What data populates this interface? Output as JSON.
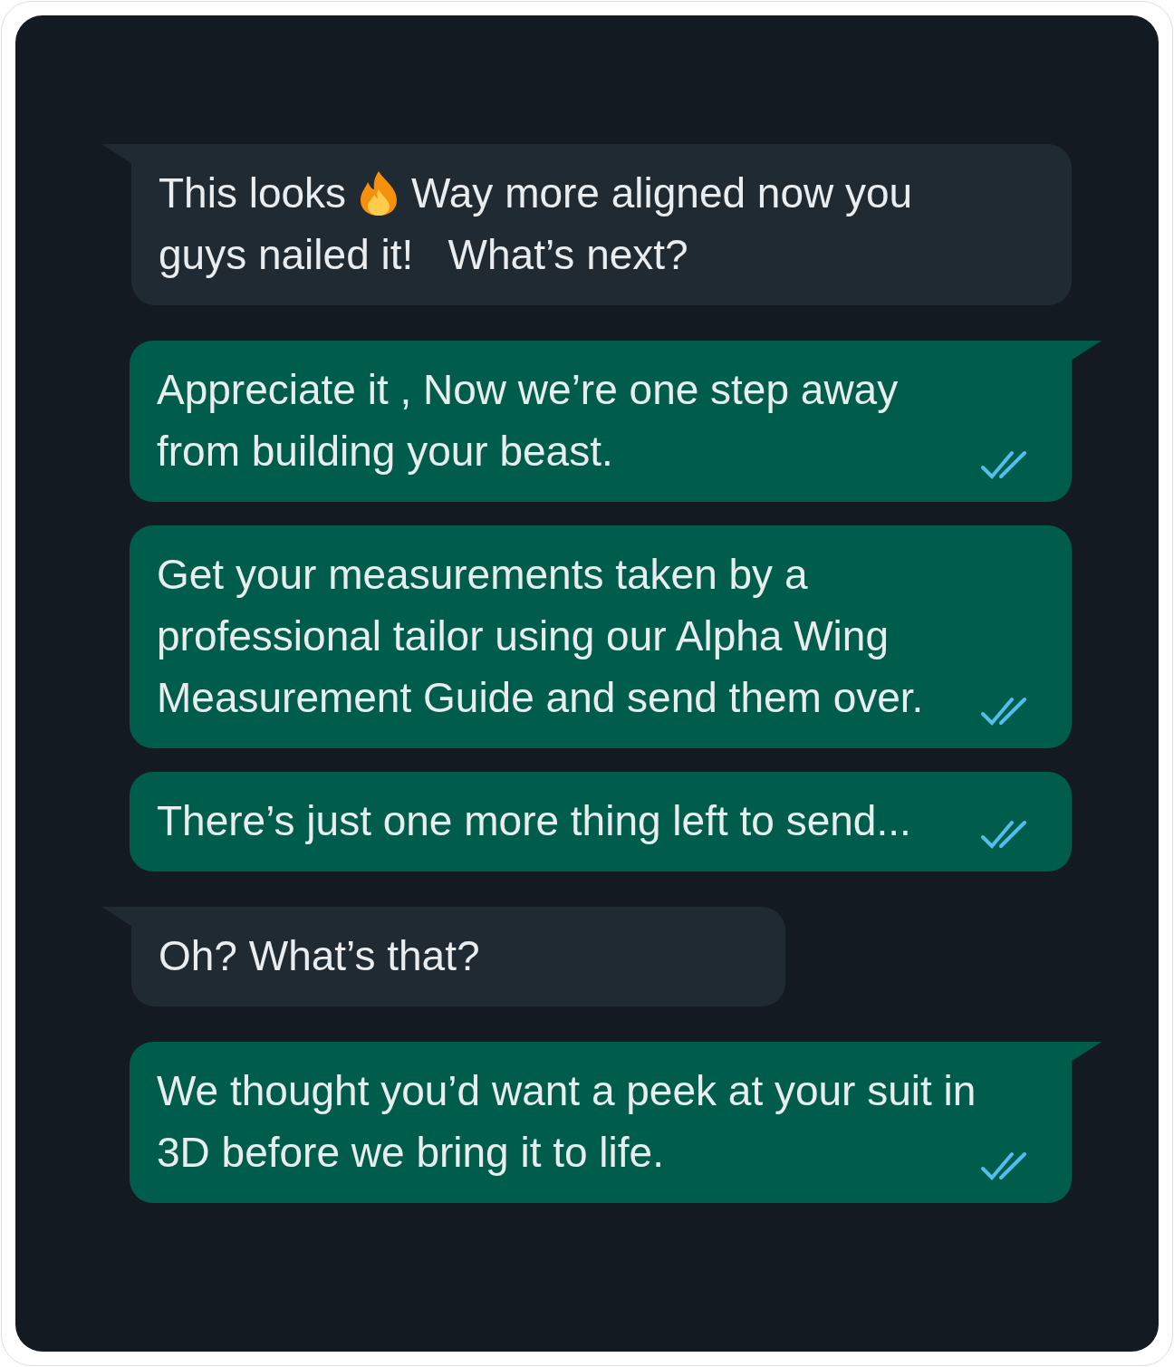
{
  "messages": [
    {
      "kind": "incoming",
      "segments": [
        "This looks",
        "Way more aligned now you guys nailed it!   What’s next?"
      ],
      "tail": true
    },
    {
      "kind": "outgoing",
      "segments": [
        "Appreciate it , Now we’re one step away from building your beast."
      ],
      "tail": true,
      "read": true
    },
    {
      "kind": "outgoing",
      "segments": [
        "Get your measurements taken by a professional tailor using our Alpha Wing Measurement Guide and send them over."
      ],
      "tail": false,
      "read": true
    },
    {
      "kind": "outgoing",
      "segments": [
        "There’s just one more thing left to send..."
      ],
      "tail": false,
      "read": true
    },
    {
      "kind": "incoming",
      "segments": [
        "Oh? What’s that?"
      ],
      "tail": true
    },
    {
      "kind": "outgoing",
      "segments": [
        "We thought you’d want a peek at your suit in 3D before we bring it to life."
      ],
      "tail": true,
      "read": true
    }
  ]
}
